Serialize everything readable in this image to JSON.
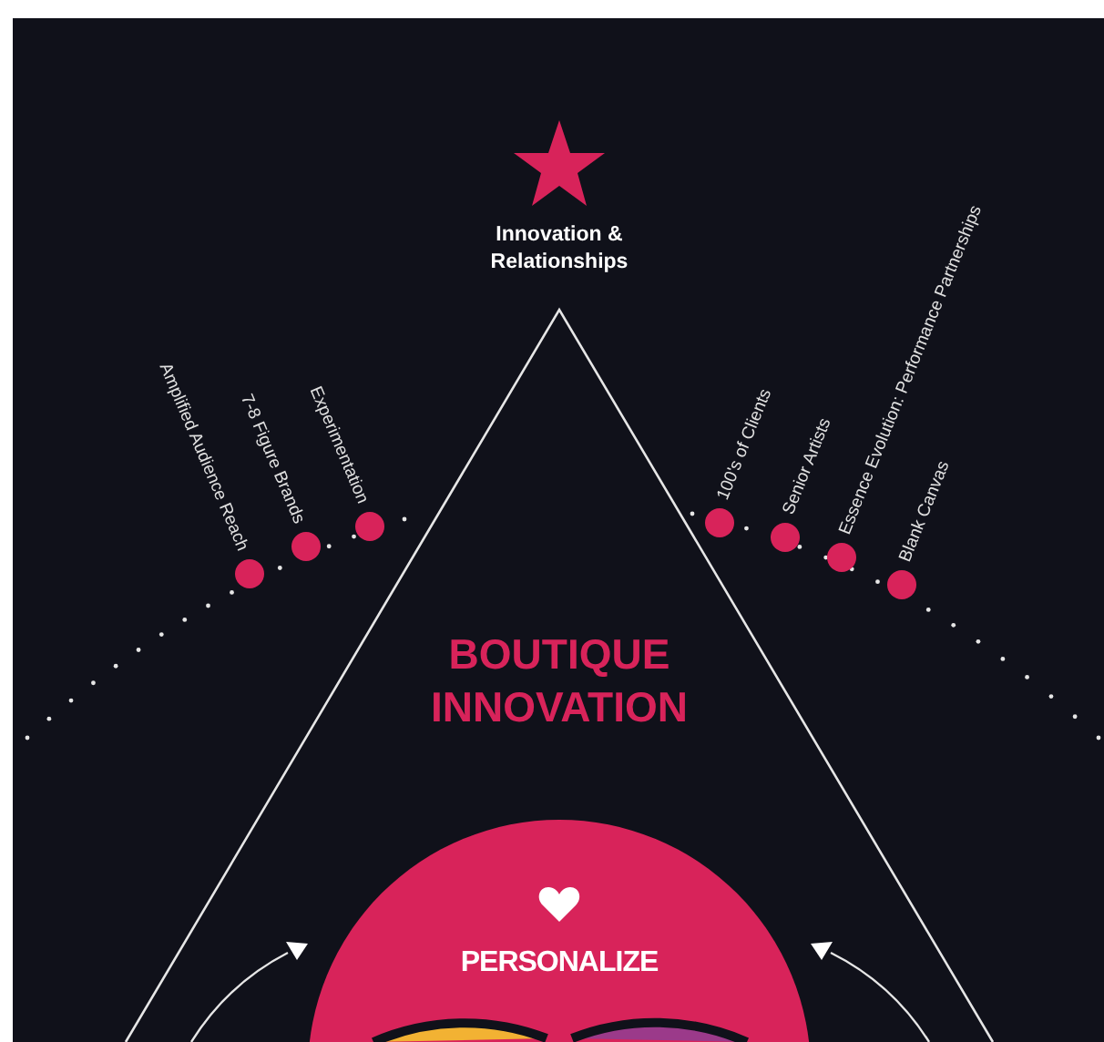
{
  "apex": {
    "title_lines": [
      "Innovation &",
      "Relationships"
    ]
  },
  "left_items": [
    {
      "label": "Amplified Audience Reach"
    },
    {
      "label": "7-8 Figure Brands"
    },
    {
      "label": "Experimentation"
    }
  ],
  "right_items": [
    {
      "label": "100's of Clients"
    },
    {
      "label": "Senior Artists"
    },
    {
      "label": "Essence Evolution: Performance Partnerships"
    },
    {
      "label": "Blank Canvas"
    }
  ],
  "heading_lines": [
    "BOUTIQUE",
    "INNOVATION"
  ],
  "circle": {
    "label": "PERSONALIZE"
  }
}
